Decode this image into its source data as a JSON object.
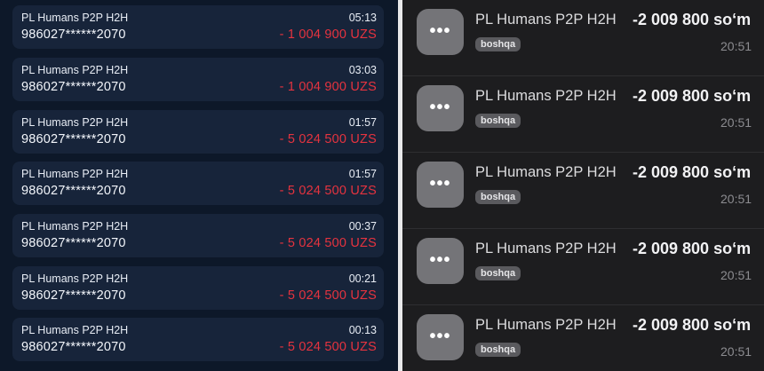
{
  "left_list": {
    "items": [
      {
        "name": "PL Humans P2P H2H",
        "account": "986027******2070",
        "time": "05:13",
        "amount": "- 1 004 900 UZS"
      },
      {
        "name": "PL Humans P2P H2H",
        "account": "986027******2070",
        "time": "03:03",
        "amount": "- 1 004 900 UZS"
      },
      {
        "name": "PL Humans P2P H2H",
        "account": "986027******2070",
        "time": "01:57",
        "amount": "- 5 024 500 UZS"
      },
      {
        "name": "PL Humans P2P H2H",
        "account": "986027******2070",
        "time": "01:57",
        "amount": "- 5 024 500 UZS"
      },
      {
        "name": "PL Humans P2P H2H",
        "account": "986027******2070",
        "time": "00:37",
        "amount": "- 5 024 500 UZS"
      },
      {
        "name": "PL Humans P2P H2H",
        "account": "986027******2070",
        "time": "00:21",
        "amount": "- 5 024 500 UZS"
      },
      {
        "name": "PL Humans P2P H2H",
        "account": "986027******2070",
        "time": "00:13",
        "amount": "- 5 024 500 UZS"
      }
    ]
  },
  "right_list": {
    "items": [
      {
        "icon": "more-dots-icon",
        "title": "PL Humans P2P H2H",
        "badge": "boshqa",
        "amount": "-2 009 800 so‘m",
        "time": "20:51"
      },
      {
        "icon": "more-dots-icon",
        "title": "PL Humans P2P H2H",
        "badge": "boshqa",
        "amount": "-2 009 800 so‘m",
        "time": "20:51"
      },
      {
        "icon": "more-dots-icon",
        "title": "PL Humans P2P H2H",
        "badge": "boshqa",
        "amount": "-2 009 800 so‘m",
        "time": "20:51"
      },
      {
        "icon": "more-dots-icon",
        "title": "PL Humans P2P H2H",
        "badge": "boshqa",
        "amount": "-2 009 800 so‘m",
        "time": "20:51"
      },
      {
        "icon": "more-dots-icon",
        "title": "PL Humans P2P H2H",
        "badge": "boshqa",
        "amount": "-2 009 800 so‘m",
        "time": "20:51"
      }
    ],
    "icon_glyph": "•••"
  },
  "colors": {
    "left_bg": "#0d1829",
    "card_bg": "#17243a",
    "negative_amount": "#e5333f",
    "right_bg": "#1d1d1f",
    "icon_bg": "#747478",
    "badge_bg": "#5a5a5e"
  }
}
